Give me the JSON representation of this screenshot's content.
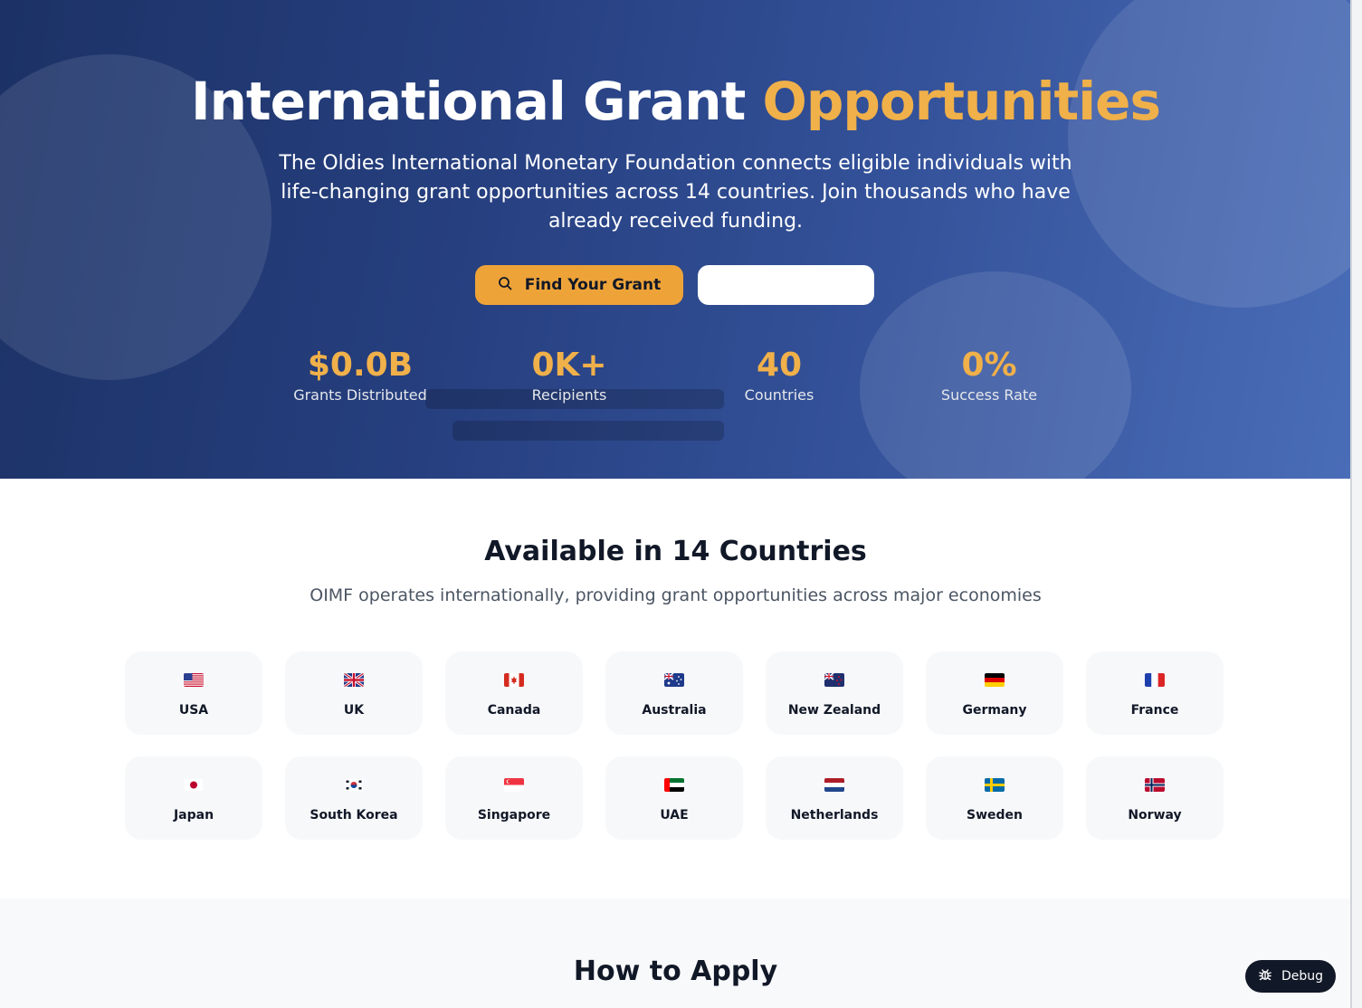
{
  "hero": {
    "title_main": "International Grant",
    "title_accent": "Opportunities",
    "subtitle": "The Oldies International Monetary Foundation connects eligible individuals with life-changing grant opportunities across 14 countries. Join thousands who have already received funding.",
    "find_button_label": "Find Your Grant",
    "find_button_icon": "search-icon",
    "secondary_button_label": "",
    "accent_color": "#f0b04a",
    "stats": [
      {
        "value": "$0.0B",
        "label": "Grants Distributed"
      },
      {
        "value": "0K+",
        "label": "Recipients"
      },
      {
        "value": "40",
        "label": "Countries"
      },
      {
        "value": "0%",
        "label": "Success Rate"
      }
    ]
  },
  "countries": {
    "title": "Available in 14 Countries",
    "subtitle": "OIMF operates internationally, providing grant opportunities across major economies",
    "items": [
      {
        "name": "USA",
        "flag": "flag-usa-icon"
      },
      {
        "name": "UK",
        "flag": "flag-uk-icon"
      },
      {
        "name": "Canada",
        "flag": "flag-canada-icon"
      },
      {
        "name": "Australia",
        "flag": "flag-australia-icon"
      },
      {
        "name": "New Zealand",
        "flag": "flag-new-zealand-icon"
      },
      {
        "name": "Germany",
        "flag": "flag-germany-icon"
      },
      {
        "name": "France",
        "flag": "flag-france-icon"
      },
      {
        "name": "Japan",
        "flag": "flag-japan-icon"
      },
      {
        "name": "South Korea",
        "flag": "flag-south-korea-icon"
      },
      {
        "name": "Singapore",
        "flag": "flag-singapore-icon"
      },
      {
        "name": "UAE",
        "flag": "flag-uae-icon"
      },
      {
        "name": "Netherlands",
        "flag": "flag-netherlands-icon"
      },
      {
        "name": "Sweden",
        "flag": "flag-sweden-icon"
      },
      {
        "name": "Norway",
        "flag": "flag-norway-icon"
      }
    ]
  },
  "how_to_apply": {
    "title": "How to Apply"
  },
  "debug": {
    "label": "Debug",
    "icon": "bug-icon"
  }
}
